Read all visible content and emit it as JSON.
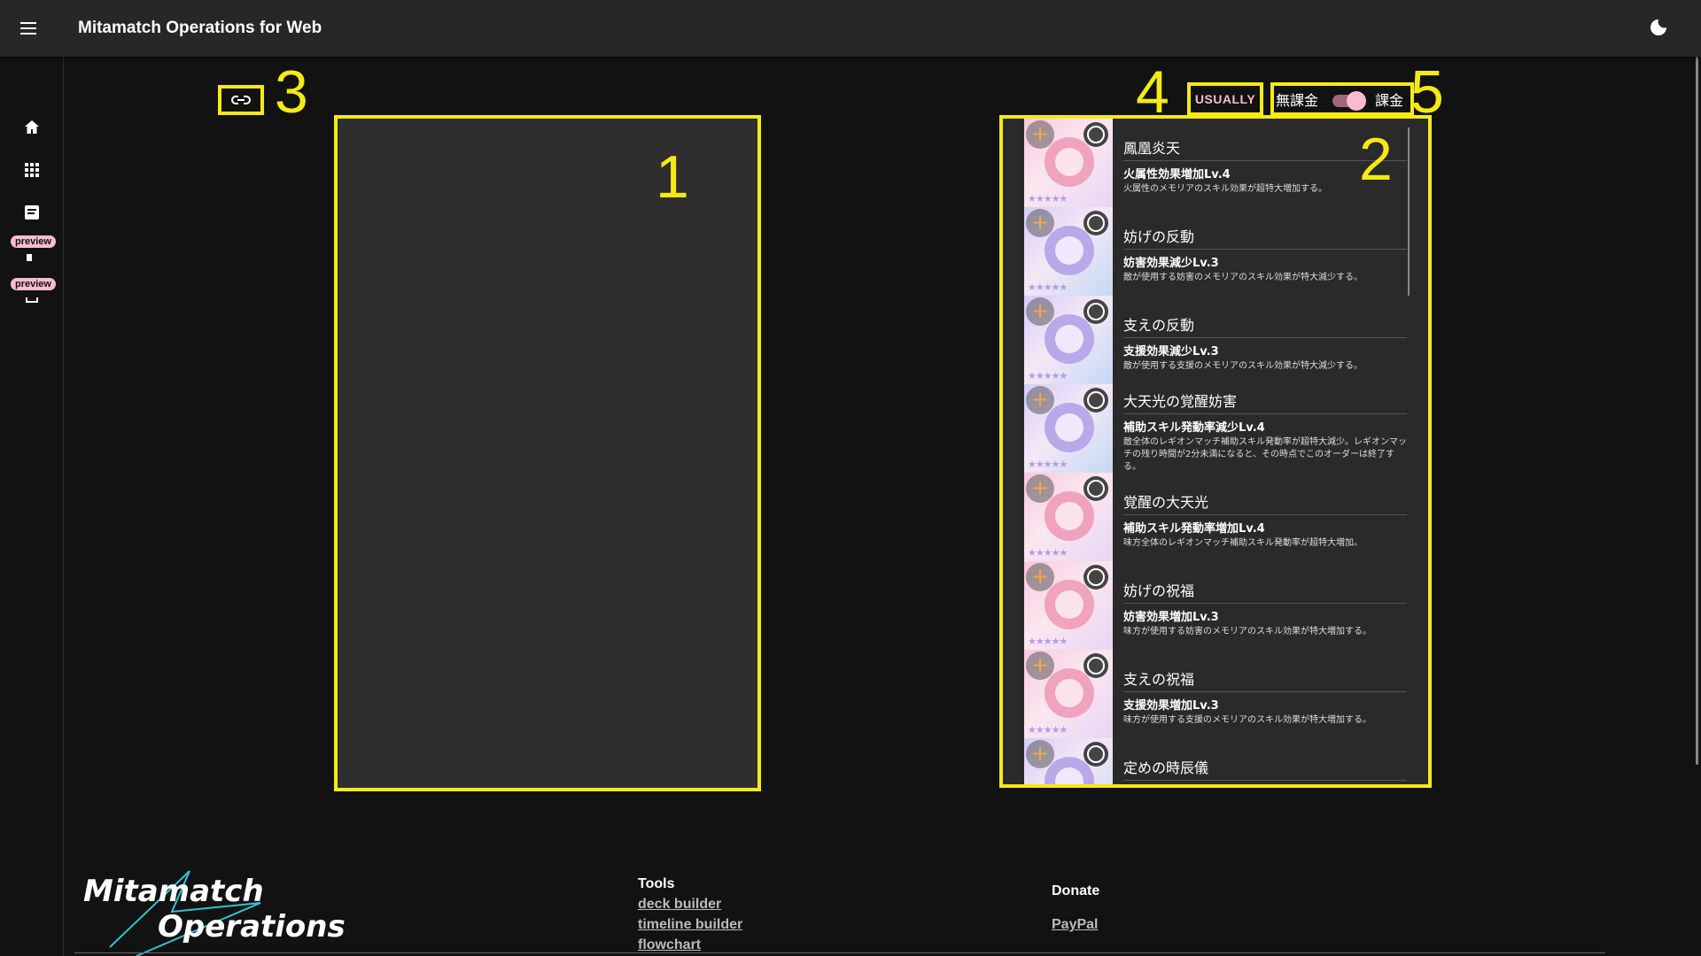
{
  "app": {
    "title": "Mitamatch Operations for Web"
  },
  "rail": {
    "badges": [
      "preview",
      "preview"
    ]
  },
  "annotations": [
    "1",
    "2",
    "3",
    "4",
    "5"
  ],
  "controls": {
    "usually_label": "USUALLY",
    "free_label": "無課金",
    "paid_label": "課金",
    "paid_enabled": true
  },
  "memoria": [
    {
      "name": "鳳凰炎天",
      "skill": "火属性効果増加Lv.4",
      "desc": "火属性のメモリアのスキル効果が超特大増加する。"
    },
    {
      "name": "妨げの反動",
      "skill": "妨害効果減少Lv.3",
      "desc": "敵が使用する妨害のメモリアのスキル効果が特大減少する。"
    },
    {
      "name": "支えの反動",
      "skill": "支援効果減少Lv.3",
      "desc": "敵が使用する支援のメモリアのスキル効果が特大減少する。"
    },
    {
      "name": "大天光の覚醒妨害",
      "skill": "補助スキル発動率減少Lv.4",
      "desc": "敵全体のレギオンマッチ補助スキル発動率が超特大減少。レギオンマッチの残り時間が2分未満になると、その時点でこのオーダーは終了する。"
    },
    {
      "name": "覚醒の大天光",
      "skill": "補助スキル発動率増加Lv.4",
      "desc": "味方全体のレギオンマッチ補助スキル発動率が超特大増加。"
    },
    {
      "name": "妨げの祝福",
      "skill": "妨害効果増加Lv.3",
      "desc": "味方が使用する妨害のメモリアのスキル効果が特大増加する。"
    },
    {
      "name": "支えの祝福",
      "skill": "支援効果増加Lv.3",
      "desc": "味方が使用する支援のメモリアのスキル効果が特大増加する。"
    },
    {
      "name": "定めの時辰儀",
      "skill": "",
      "desc": ""
    }
  ],
  "footer": {
    "tools_heading": "Tools",
    "tools_links": [
      "deck builder",
      "timeline builder",
      "flowchart"
    ],
    "donate_heading": "Donate",
    "donate_links": [
      "PayPal"
    ]
  }
}
